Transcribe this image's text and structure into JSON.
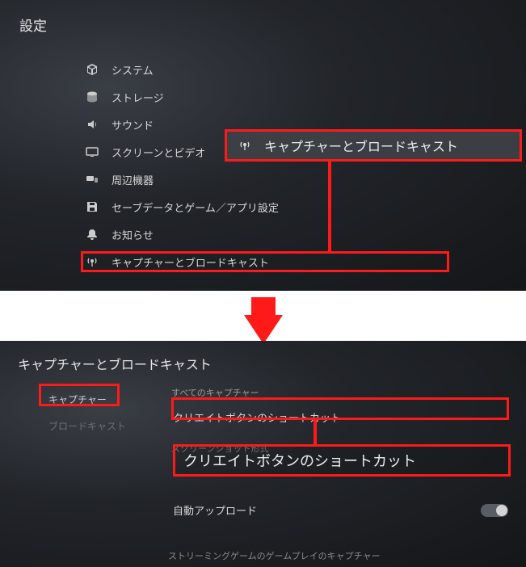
{
  "top": {
    "title": "設定",
    "menu": [
      {
        "label": "システム",
        "icon": "cube"
      },
      {
        "label": "ストレージ",
        "icon": "disk"
      },
      {
        "label": "サウンド",
        "icon": "speaker"
      },
      {
        "label": "スクリーンとビデオ",
        "icon": "screen"
      },
      {
        "label": "周辺機器",
        "icon": "peripherals"
      },
      {
        "label": "セーブデータとゲーム／アプリ設定",
        "icon": "save"
      },
      {
        "label": "お知らせ",
        "icon": "bell"
      },
      {
        "label": "キャプチャーとブロードキャスト",
        "icon": "broadcast"
      }
    ],
    "callout": "キャプチャーとブロードキャスト"
  },
  "bottom": {
    "title": "キャプチャーとブロードキャスト",
    "nav": {
      "capture": "キャプチャー",
      "broadcast": "ブロードキャスト"
    },
    "section1_label": "すべてのキャプチャー",
    "row1": "クリエイトボタンのショートカット",
    "section2_label": "スクリーンショット形式",
    "big_callout": "クリエイトボタンのショートカット",
    "row_auto": "自動アップロード",
    "footer": "ストリーミングゲームのゲームプレイのキャプチャー"
  }
}
